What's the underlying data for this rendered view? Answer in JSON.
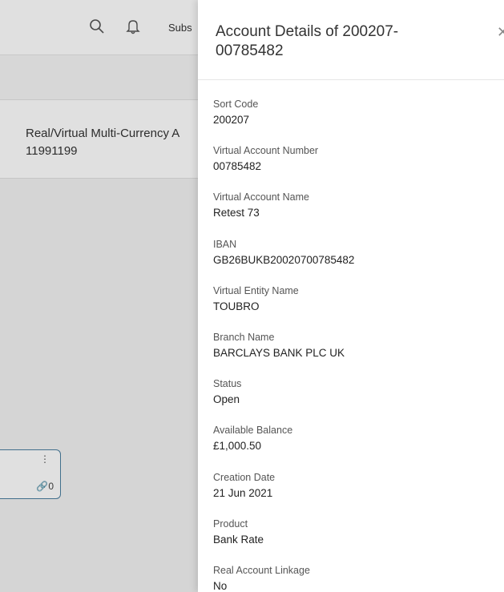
{
  "background": {
    "header": {
      "subscribe_partial": "Subs"
    },
    "account": {
      "name": "Real/Virtual Multi-Currency A",
      "number": "11991199"
    },
    "card": {
      "link_count": "0"
    }
  },
  "drawer": {
    "title": "Account Details of 200207-00785482",
    "fields": [
      {
        "label": "Sort Code",
        "value": "200207"
      },
      {
        "label": "Virtual Account Number",
        "value": "00785482"
      },
      {
        "label": "Virtual Account Name",
        "value": "Retest 73"
      },
      {
        "label": "IBAN",
        "value": "GB26BUKB20020700785482"
      },
      {
        "label": "Virtual Entity Name",
        "value": "TOUBRO"
      },
      {
        "label": "Branch Name",
        "value": "BARCLAYS BANK PLC UK"
      },
      {
        "label": "Status",
        "value": "Open"
      },
      {
        "label": "Available Balance",
        "value": "£1,000.50"
      },
      {
        "label": "Creation Date",
        "value": "21 Jun 2021"
      },
      {
        "label": "Product",
        "value": "Bank Rate"
      },
      {
        "label": "Real Account Linkage",
        "value": "No"
      }
    ]
  }
}
